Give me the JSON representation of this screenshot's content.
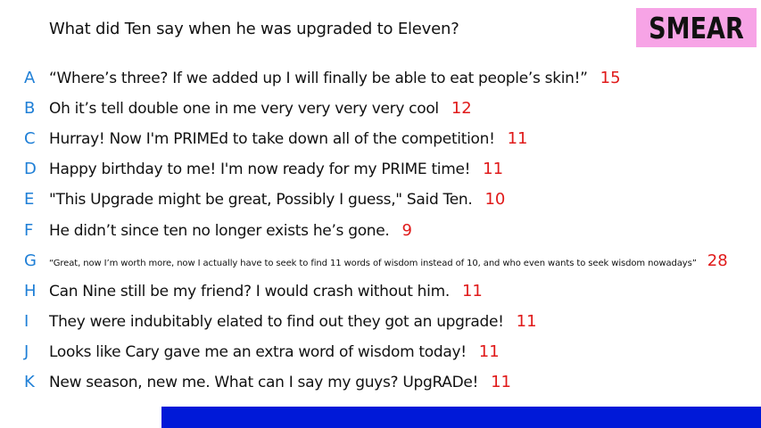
{
  "question": "What did Ten say when he was upgraded to Eleven?",
  "title": "SMEAR",
  "colors": {
    "title_bg": "#f7a4e6",
    "letter": "#1f7fd6",
    "count": "#e01a1a",
    "bottom_bar": "#0019d8",
    "text": "#111111"
  },
  "answers": [
    {
      "letter": "A",
      "text": "“Where’s three? If we added up I will finally be able to eat people’s skin!”",
      "count": "15"
    },
    {
      "letter": "B",
      "text": "Oh it’s tell double one in me very very very very cool",
      "count": "12"
    },
    {
      "letter": "C",
      "text": "Hurray! Now I'm PRIMEd to take down all of the competition!",
      "count": "11"
    },
    {
      "letter": "D",
      "text": "Happy birthday to me! I'm now ready for my PRIME time!",
      "count": "11"
    },
    {
      "letter": "E",
      "text": "\"This Upgrade might be great, Possibly I guess,\" Said Ten.",
      "count": "10"
    },
    {
      "letter": "F",
      "text": "He didn’t since ten no longer exists he’s gone.",
      "count": "9"
    },
    {
      "letter": "G",
      "text": "“Great, now I’m worth more, now I actually have to seek to find 11 words of wisdom instead of 10, and who even wants to seek wisdom nowadays”",
      "count": "28"
    },
    {
      "letter": "H",
      "text": "Can Nine still be my friend? I would crash without him.",
      "count": "11"
    },
    {
      "letter": "I",
      "text": "They were indubitably elated to find out they got an upgrade!",
      "count": "11"
    },
    {
      "letter": "J",
      "text": "Looks like Cary gave me an extra word of wisdom today!",
      "count": "11"
    },
    {
      "letter": "K",
      "text": "New season, new me. What can I say my guys? UpgRADe!",
      "count": "11"
    }
  ]
}
